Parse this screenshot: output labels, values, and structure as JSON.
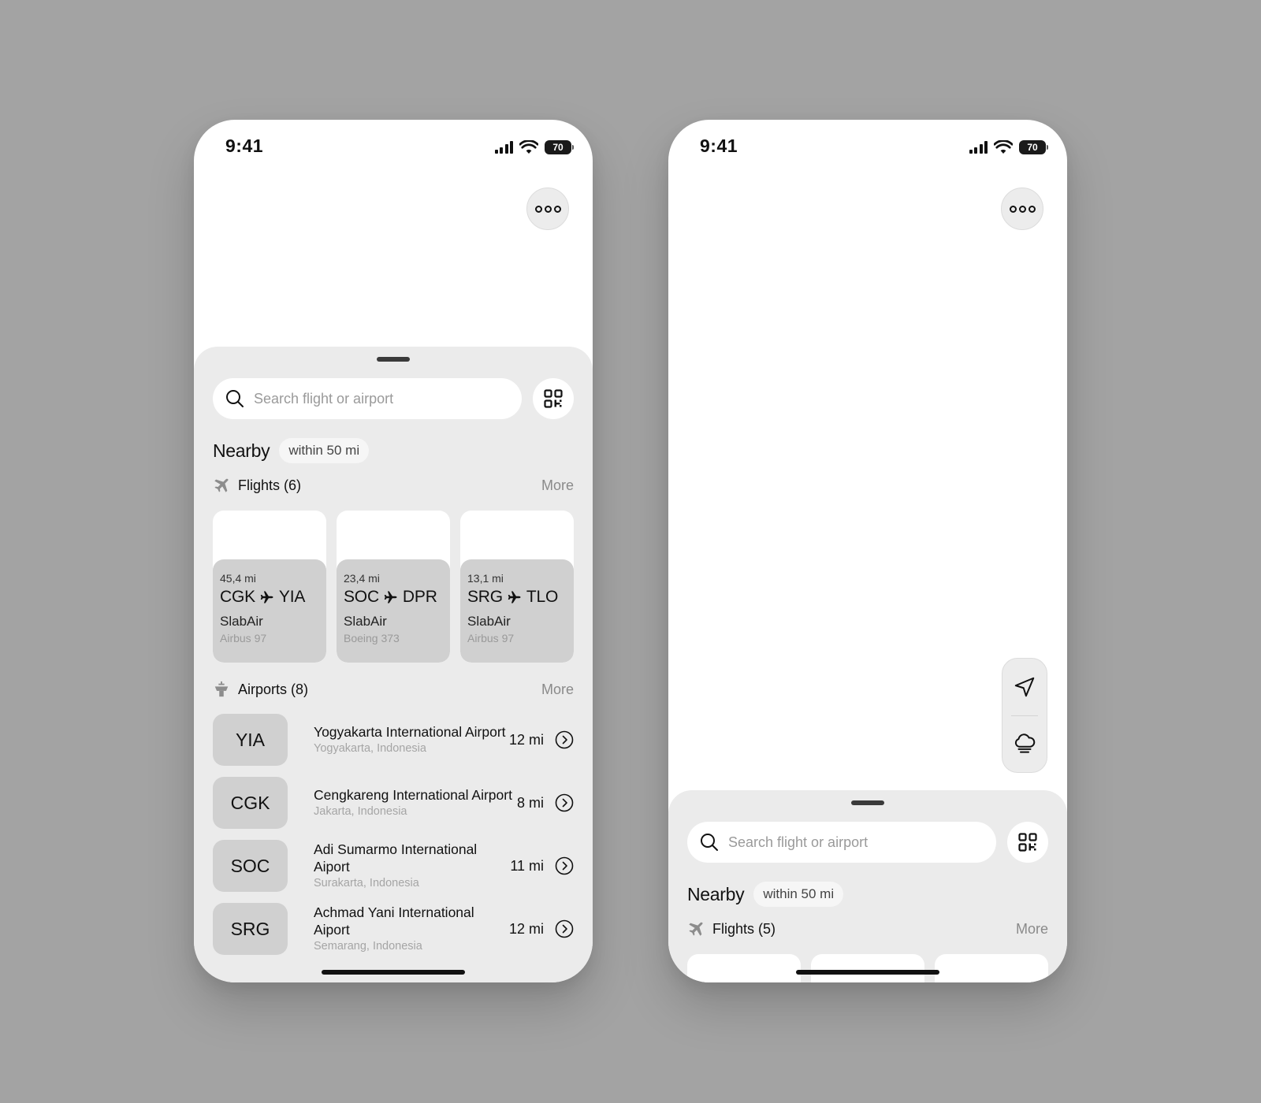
{
  "colors": {
    "backdrop": "#a3a3a3",
    "sheet": "#ebebeb",
    "card_info": "#d0d0d0",
    "text_primary": "#111111",
    "text_muted": "#8a8a8a"
  },
  "screens": [
    {
      "status": {
        "time": "9:41",
        "battery": "70"
      },
      "more_button_icon": "ellipsis-circles-icon",
      "search": {
        "placeholder": "Search flight or airport",
        "value": ""
      },
      "nearby": {
        "title": "Nearby",
        "radius": "within 50 mi"
      },
      "flights": {
        "title": "Flights (6)",
        "more": "More",
        "cards": [
          {
            "distance": "45,4 mi",
            "from": "CGK",
            "to": "YIA",
            "airline": "SlabAir",
            "aircraft": "Airbus 97"
          },
          {
            "distance": "23,4 mi",
            "from": "SOC",
            "to": "DPR",
            "airline": "SlabAir",
            "aircraft": "Boeing 373"
          },
          {
            "distance": "13,1 mi",
            "from": "SRG",
            "to": "TLO",
            "airline": "SlabAir",
            "aircraft": "Airbus 97"
          }
        ]
      },
      "airports": {
        "title": "Airports (8)",
        "more": "More",
        "items": [
          {
            "code": "YIA",
            "name": "Yogyakarta International Airport",
            "location": "Yogyakarta, Indonesia",
            "distance": "12 mi"
          },
          {
            "code": "CGK",
            "name": "Cengkareng International Airport",
            "location": "Jakarta, Indonesia",
            "distance": "8 mi"
          },
          {
            "code": "SOC",
            "name": "Adi Sumarmo International Aiport",
            "location": "Surakarta, Indonesia",
            "distance": "11 mi"
          },
          {
            "code": "SRG",
            "name": "Achmad Yani International Aiport",
            "location": "Semarang, Indonesia",
            "distance": "12 mi"
          }
        ]
      }
    },
    {
      "status": {
        "time": "9:41",
        "battery": "70"
      },
      "more_button_icon": "ellipsis-circles-icon",
      "map_controls": [
        "location-arrow-icon",
        "weather-fog-icon"
      ],
      "search": {
        "placeholder": "Search flight or airport",
        "value": ""
      },
      "nearby": {
        "title": "Nearby",
        "radius": "within 50 mi"
      },
      "flights": {
        "title": "Flights (5)",
        "more": "More"
      }
    }
  ]
}
